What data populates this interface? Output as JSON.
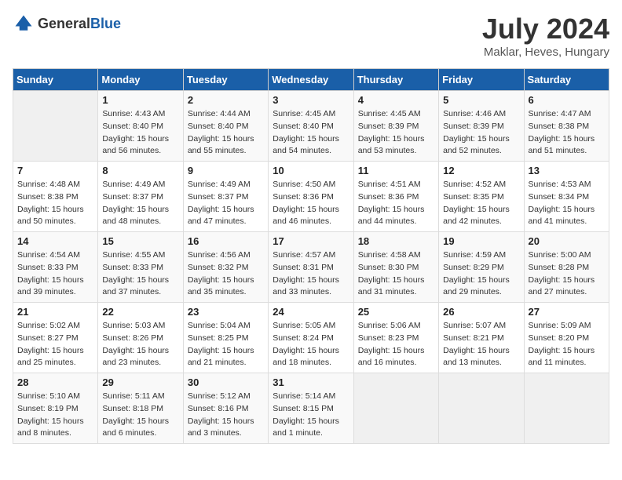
{
  "logo": {
    "text_general": "General",
    "text_blue": "Blue"
  },
  "header": {
    "month": "July 2024",
    "location": "Maklar, Heves, Hungary"
  },
  "weekdays": [
    "Sunday",
    "Monday",
    "Tuesday",
    "Wednesday",
    "Thursday",
    "Friday",
    "Saturday"
  ],
  "weeks": [
    [
      {
        "day": "",
        "sunrise": "",
        "sunset": "",
        "daylight": ""
      },
      {
        "day": "1",
        "sunrise": "Sunrise: 4:43 AM",
        "sunset": "Sunset: 8:40 PM",
        "daylight": "Daylight: 15 hours and 56 minutes."
      },
      {
        "day": "2",
        "sunrise": "Sunrise: 4:44 AM",
        "sunset": "Sunset: 8:40 PM",
        "daylight": "Daylight: 15 hours and 55 minutes."
      },
      {
        "day": "3",
        "sunrise": "Sunrise: 4:45 AM",
        "sunset": "Sunset: 8:40 PM",
        "daylight": "Daylight: 15 hours and 54 minutes."
      },
      {
        "day": "4",
        "sunrise": "Sunrise: 4:45 AM",
        "sunset": "Sunset: 8:39 PM",
        "daylight": "Daylight: 15 hours and 53 minutes."
      },
      {
        "day": "5",
        "sunrise": "Sunrise: 4:46 AM",
        "sunset": "Sunset: 8:39 PM",
        "daylight": "Daylight: 15 hours and 52 minutes."
      },
      {
        "day": "6",
        "sunrise": "Sunrise: 4:47 AM",
        "sunset": "Sunset: 8:38 PM",
        "daylight": "Daylight: 15 hours and 51 minutes."
      }
    ],
    [
      {
        "day": "7",
        "sunrise": "Sunrise: 4:48 AM",
        "sunset": "Sunset: 8:38 PM",
        "daylight": "Daylight: 15 hours and 50 minutes."
      },
      {
        "day": "8",
        "sunrise": "Sunrise: 4:49 AM",
        "sunset": "Sunset: 8:37 PM",
        "daylight": "Daylight: 15 hours and 48 minutes."
      },
      {
        "day": "9",
        "sunrise": "Sunrise: 4:49 AM",
        "sunset": "Sunset: 8:37 PM",
        "daylight": "Daylight: 15 hours and 47 minutes."
      },
      {
        "day": "10",
        "sunrise": "Sunrise: 4:50 AM",
        "sunset": "Sunset: 8:36 PM",
        "daylight": "Daylight: 15 hours and 46 minutes."
      },
      {
        "day": "11",
        "sunrise": "Sunrise: 4:51 AM",
        "sunset": "Sunset: 8:36 PM",
        "daylight": "Daylight: 15 hours and 44 minutes."
      },
      {
        "day": "12",
        "sunrise": "Sunrise: 4:52 AM",
        "sunset": "Sunset: 8:35 PM",
        "daylight": "Daylight: 15 hours and 42 minutes."
      },
      {
        "day": "13",
        "sunrise": "Sunrise: 4:53 AM",
        "sunset": "Sunset: 8:34 PM",
        "daylight": "Daylight: 15 hours and 41 minutes."
      }
    ],
    [
      {
        "day": "14",
        "sunrise": "Sunrise: 4:54 AM",
        "sunset": "Sunset: 8:33 PM",
        "daylight": "Daylight: 15 hours and 39 minutes."
      },
      {
        "day": "15",
        "sunrise": "Sunrise: 4:55 AM",
        "sunset": "Sunset: 8:33 PM",
        "daylight": "Daylight: 15 hours and 37 minutes."
      },
      {
        "day": "16",
        "sunrise": "Sunrise: 4:56 AM",
        "sunset": "Sunset: 8:32 PM",
        "daylight": "Daylight: 15 hours and 35 minutes."
      },
      {
        "day": "17",
        "sunrise": "Sunrise: 4:57 AM",
        "sunset": "Sunset: 8:31 PM",
        "daylight": "Daylight: 15 hours and 33 minutes."
      },
      {
        "day": "18",
        "sunrise": "Sunrise: 4:58 AM",
        "sunset": "Sunset: 8:30 PM",
        "daylight": "Daylight: 15 hours and 31 minutes."
      },
      {
        "day": "19",
        "sunrise": "Sunrise: 4:59 AM",
        "sunset": "Sunset: 8:29 PM",
        "daylight": "Daylight: 15 hours and 29 minutes."
      },
      {
        "day": "20",
        "sunrise": "Sunrise: 5:00 AM",
        "sunset": "Sunset: 8:28 PM",
        "daylight": "Daylight: 15 hours and 27 minutes."
      }
    ],
    [
      {
        "day": "21",
        "sunrise": "Sunrise: 5:02 AM",
        "sunset": "Sunset: 8:27 PM",
        "daylight": "Daylight: 15 hours and 25 minutes."
      },
      {
        "day": "22",
        "sunrise": "Sunrise: 5:03 AM",
        "sunset": "Sunset: 8:26 PM",
        "daylight": "Daylight: 15 hours and 23 minutes."
      },
      {
        "day": "23",
        "sunrise": "Sunrise: 5:04 AM",
        "sunset": "Sunset: 8:25 PM",
        "daylight": "Daylight: 15 hours and 21 minutes."
      },
      {
        "day": "24",
        "sunrise": "Sunrise: 5:05 AM",
        "sunset": "Sunset: 8:24 PM",
        "daylight": "Daylight: 15 hours and 18 minutes."
      },
      {
        "day": "25",
        "sunrise": "Sunrise: 5:06 AM",
        "sunset": "Sunset: 8:23 PM",
        "daylight": "Daylight: 15 hours and 16 minutes."
      },
      {
        "day": "26",
        "sunrise": "Sunrise: 5:07 AM",
        "sunset": "Sunset: 8:21 PM",
        "daylight": "Daylight: 15 hours and 13 minutes."
      },
      {
        "day": "27",
        "sunrise": "Sunrise: 5:09 AM",
        "sunset": "Sunset: 8:20 PM",
        "daylight": "Daylight: 15 hours and 11 minutes."
      }
    ],
    [
      {
        "day": "28",
        "sunrise": "Sunrise: 5:10 AM",
        "sunset": "Sunset: 8:19 PM",
        "daylight": "Daylight: 15 hours and 8 minutes."
      },
      {
        "day": "29",
        "sunrise": "Sunrise: 5:11 AM",
        "sunset": "Sunset: 8:18 PM",
        "daylight": "Daylight: 15 hours and 6 minutes."
      },
      {
        "day": "30",
        "sunrise": "Sunrise: 5:12 AM",
        "sunset": "Sunset: 8:16 PM",
        "daylight": "Daylight: 15 hours and 3 minutes."
      },
      {
        "day": "31",
        "sunrise": "Sunrise: 5:14 AM",
        "sunset": "Sunset: 8:15 PM",
        "daylight": "Daylight: 15 hours and 1 minute."
      },
      {
        "day": "",
        "sunrise": "",
        "sunset": "",
        "daylight": ""
      },
      {
        "day": "",
        "sunrise": "",
        "sunset": "",
        "daylight": ""
      },
      {
        "day": "",
        "sunrise": "",
        "sunset": "",
        "daylight": ""
      }
    ]
  ]
}
